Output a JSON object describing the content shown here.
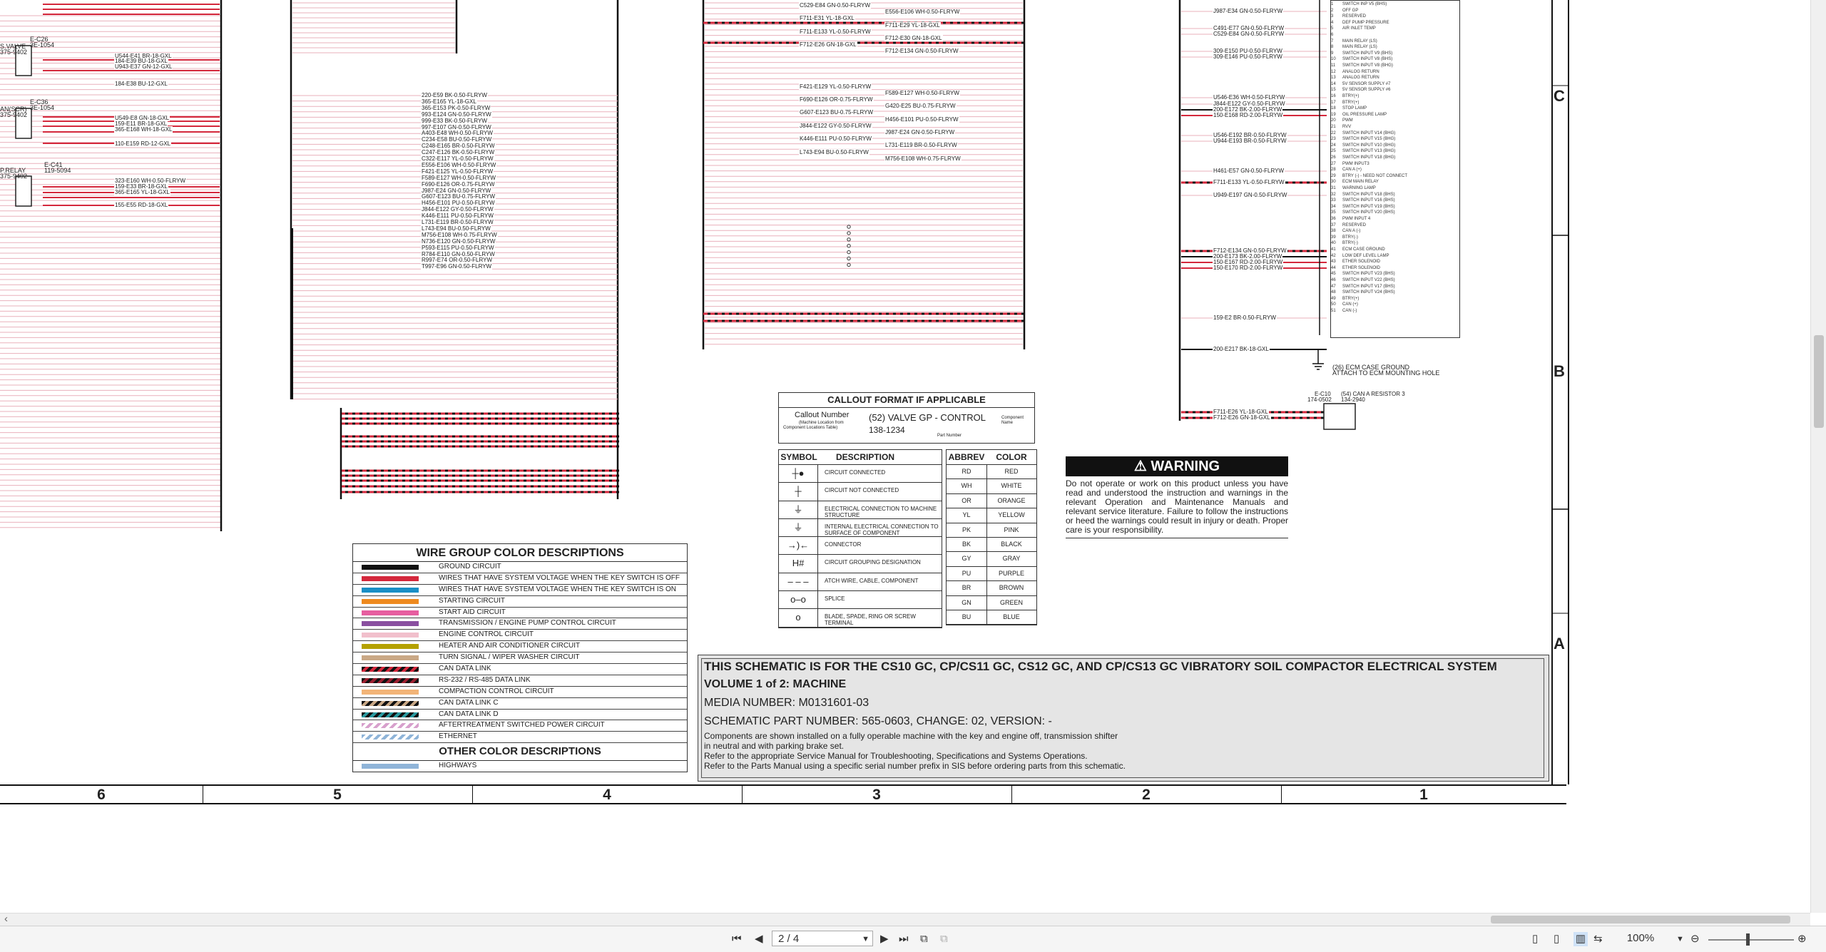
{
  "schematic": {
    "zones_bottom": [
      "6",
      "5",
      "4",
      "3",
      "2",
      "1"
    ],
    "zones_right": [
      "C",
      "B",
      "A"
    ],
    "connector_labels": [
      {
        "name": "E-C26",
        "part": "3E-1054",
        "desc": "S.VALVE",
        "num": "375-9402"
      },
      {
        "name": "E-C36",
        "part": "3E-1054",
        "desc": "AN(SCR)",
        "num": "375-9402"
      },
      {
        "name": "E-C41",
        "part": "119-5094",
        "desc": "P.RELAY",
        "num": "375-9402"
      }
    ],
    "left_wires": [
      "U544-E41 BR-18-GXL",
      "184-E39 BU-18-GXL",
      "U943-E37 GN-12-GXL",
      "184-E38 BU-12-GXL",
      "U549-E8 GN-18-GXL",
      "159-E11 BR-18-GXL",
      "365-E168 WH-18-GXL",
      "110-E159 RD-12-GXL",
      "323-E160 WH-0.50-FLRYW",
      "159-E33 BR-18-GXL",
      "365-E165 YL-18-GXL",
      "155-E55 RD-18-GXL"
    ],
    "mid_wires": [
      "220-E59 BK-0.50-FLRYW",
      "365-E165 YL-18-GXL",
      "365-E153 PK-0.50-FLRYW",
      "993-E124 GN-0.50-FLRYW",
      "999-E33 BK-0.50-FLRYW",
      "997-E107 GN-0.50-FLRYW",
      "A403-E48 WH-0.50-FLRYW",
      "C234-E58 BU-0.50-FLRYW",
      "C248-E165 BR-0.50-FLRYW",
      "C247-E126 BK-0.50-FLRYW",
      "C322-E117 YL-0.50-FLRYW",
      "E556-E106 WH-0.50-FLRYW",
      "F421-E125 YL-0.50-FLRYW",
      "F589-E127 WH-0.50-FLRYW",
      "F690-E126 OR-0.75-FLRYW",
      "J987-E24 GN-0.50-FLRYW",
      "G607-E123 BU-0.75-FLRYW",
      "H456-E101 PU-0.50-FLRYW",
      "J844-E122 GY-0.50-FLRYW",
      "K446-E111 PU-0.50-FLRYW",
      "L731-E119 BR-0.50-FLRYW",
      "L743-E94 BU-0.50-FLRYW",
      "M756-E108 WH-0.75-FLRYW",
      "N736-E120 GN-0.50-FLRYW",
      "P593-E115 PU-0.50-FLRYW",
      "R784-E110 GN-0.50-FLRYW",
      "R997-E74 OR-0.50-FLRYW",
      "T997-E96 GN-0.50-FLRYW"
    ],
    "right_mid_wires": [
      "C529-E84 GN-0.50-FLRYW",
      "E556-E106 WH-0.50-FLRYW",
      "F711-E31 YL-18-GXL",
      "F711-E29 YL-18-GXL",
      "F711-E133 YL-0.50-FLRYW",
      "F712-E30 GN-18-GXL",
      "F712-E26 GN-18-GXL",
      "F712-E134 GN-0.50-FLRYW",
      "F421-E129 YL-0.50-FLRYW",
      "F589-E127 WH-0.50-FLRYW",
      "F690-E126 OR-0.75-FLRYW",
      "G420-E25 BU-0.75-FLRYW",
      "G607-E123 BU-0.75-FLRYW",
      "H456-E101 PU-0.50-FLRYW",
      "J844-E122 GY-0.50-FLRYW",
      "J987-E24 GN-0.50-FLRYW",
      "K446-E111 PU-0.50-FLRYW",
      "L731-E119 BR-0.50-FLRYW",
      "L743-E94 BU-0.50-FLRYW",
      "M756-E108 WH-0.75-FLRYW"
    ],
    "ecm_wires": [
      "J987-E34 GN-0.50-FLRYW",
      "C491-E77 GN-0.50-FLRYW",
      "C529-E84 GN-0.50-FLRYW",
      "309-E150 PU-0.50-FLRYW",
      "309-E146 PU-0.50-FLRYW",
      "U546-E36 WH-0.50-FLRYW",
      "J844-E122 GY-0.50-FLRYW",
      "200-E172 BK-2.00-FLRYW",
      "150-E168 RD-2.00-FLRYW",
      "U546-E192 BR-0.50-FLRYW",
      "U944-E193 BR-0.50-FLRYW",
      "H461-E57 GN-0.50-FLRYW",
      "F711-E133 YL-0.50-FLRYW",
      "U949-E197 GN-0.50-FLRYW",
      "F712-E134 GN-0.50-FLRYW",
      "200-E173 BK-2.00-FLRYW",
      "150-E167 RD-2.00-FLRYW",
      "150-E170 RD-2.00-FLRYW",
      "159-E2 BR-0.50-FLRYW",
      "200-E217 BK-18-GXL",
      "F711-E26 YL-18-GXL",
      "F712-E26 GN-18-GXL"
    ],
    "ecm_pins": [
      "SWITCH INP V5 (BHS)",
      "OFF GP",
      "RESERVED",
      "DEF PUMP PRESSURE",
      "AIR INLET TEMP",
      "",
      "MAIN RELAY (LS)",
      "MAIN RELAY (LS)",
      "SWITCH INPUT V9 (BHS)",
      "SWITCH INPUT V8 (BHS)",
      "SWITCH INPUT V8 (BHG)",
      "ANALOG RETURN",
      "ANALOG RETURN",
      "5V SENSOR SUPPLY #7",
      "5V SENSOR SUPPLY #6",
      "BTRY(+)",
      "BTRY(+)",
      "STOP LAMP",
      "OIL PRESSURE LAMP",
      "PWM",
      "RVV",
      "SWITCH INPUT V14 (BHG)",
      "SWITCH INPUT V15 (BHG)",
      "SWITCH INPUT V10 (BHG)",
      "SWITCH INPUT V13 (BHG)",
      "SWITCH INPUT V18 (BHG)",
      "PWM INPUT3",
      "CAN A (+)",
      "BTRY (-) - NEED NOT CONNECT",
      "ECM MAIN RELAY",
      "WARNING LAMP",
      "SWITCH INPUT V18 (BHS)",
      "SWITCH INPUT V16 (BHS)",
      "SWITCH INPUT V19 (BHS)",
      "SWITCH INPUT V20 (BHS)",
      "PWM INPUT 4",
      "RESERVED",
      "CAN A (-)",
      "BTRY(-)",
      "BTRY(-)",
      "ECM CASE GROUND",
      "LOW DEF LEVEL LAMP",
      "ETHER SOLENOID",
      "ETHER SOLENOID",
      "SWITCH INPUT V23 (BHS)",
      "SWITCH INPUT V22 (BHS)",
      "SWITCH INPUT V17 (BHS)",
      "SWITCH INPUT V24 (BHS)",
      "BTRY(+)",
      "CAN (+)",
      "CAN (-)"
    ],
    "ground_note": "(26) ECM CASE GROUND",
    "ground_note2": "ATTACH TO ECM MOUNTING HOLE",
    "resistor_label": "E-C10",
    "resistor_part": "174-0502",
    "resistor_desc": "(54) CAN A RESISTOR 3",
    "resistor_num": "134-2940"
  },
  "wire_group": {
    "title": "WIRE GROUP COLOR DESCRIPTIONS",
    "rows": [
      {
        "color": "#111111",
        "label": "GROUND CIRCUIT"
      },
      {
        "color": "#d4283c",
        "label": "WIRES THAT HAVE SYSTEM VOLTAGE WHEN THE KEY SWITCH IS OFF"
      },
      {
        "color": "#1a8fc6",
        "label": "WIRES THAT HAVE SYSTEM VOLTAGE WHEN THE KEY SWITCH IS ON"
      },
      {
        "color": "#ee8a1e",
        "label": "STARTING CIRCUIT"
      },
      {
        "color": "#e65ea0",
        "label": "START AID CIRCUIT"
      },
      {
        "color": "#8a4fa0",
        "label": "TRANSMISSION / ENGINE PUMP CONTROL CIRCUIT"
      },
      {
        "color": "#f1c0cc",
        "label": "ENGINE CONTROL CIRCUIT"
      },
      {
        "color": "#b4a100",
        "label": "HEATER AND AIR CONDITIONER CIRCUIT"
      },
      {
        "color": "#c9a886",
        "label": "TURN SIGNAL / WIPER WASHER CIRCUIT"
      },
      {
        "color": "hatch-red",
        "label": "CAN DATA LINK"
      },
      {
        "color": "hatch-dkred",
        "label": "RS-232 / RS-485 DATA LINK"
      },
      {
        "color": "#f2b478",
        "label": "COMPACTION CONTROL CIRCUIT"
      },
      {
        "color": "hatch-tan",
        "label": "CAN DATA LINK C"
      },
      {
        "color": "hatch-teal",
        "label": "CAN DATA LINK D"
      },
      {
        "color": "hatch-pink",
        "label": "AFTERTREATMENT SWITCHED POWER CIRCUIT"
      },
      {
        "color": "hatch-blue",
        "label": "ETHERNET"
      }
    ],
    "other_title": "OTHER COLOR DESCRIPTIONS",
    "other_rows": [
      {
        "color": "#8fb4d8",
        "label": "HIGHWAYS"
      }
    ]
  },
  "callout": {
    "title": "CALLOUT FORMAT IF APPLICABLE",
    "callout_number": "Callout Number",
    "machine_loc": "(Machine Location from",
    "loc_table": "Component Locations Table)",
    "example": "(52) VALVE GP - CONTROL",
    "part": "138-1234",
    "component_name": "Component",
    "name_word": "Name",
    "part_number": "Part Number"
  },
  "symbols": {
    "h_symbol": "SYMBOL",
    "h_desc": "DESCRIPTION",
    "rows": [
      {
        "sym": "┼●",
        "desc": "CIRCUIT CONNECTED"
      },
      {
        "sym": "┼",
        "desc": "CIRCUIT NOT CONNECTED"
      },
      {
        "sym": "⏚",
        "desc": "ELECTRICAL CONNECTION TO MACHINE STRUCTURE"
      },
      {
        "sym": "⏚",
        "desc": "INTERNAL ELECTRICAL CONNECTION TO SURFACE OF COMPONENT"
      },
      {
        "sym": "→)←",
        "desc": "CONNECTOR"
      },
      {
        "sym": "H#",
        "desc": "CIRCUIT GROUPING DESIGNATION"
      },
      {
        "sym": "– – –",
        "desc": "ATCH WIRE, CABLE, COMPONENT"
      },
      {
        "sym": "o–o",
        "desc": "SPLICE"
      },
      {
        "sym": "o",
        "desc": "BLADE, SPADE, RING OR SCREW TERMINAL"
      }
    ]
  },
  "abbrev": {
    "h_abbrev": "ABBREV",
    "h_color": "COLOR",
    "rows": [
      {
        "a": "RD",
        "c": "RED"
      },
      {
        "a": "WH",
        "c": "WHITE"
      },
      {
        "a": "OR",
        "c": "ORANGE"
      },
      {
        "a": "YL",
        "c": "YELLOW"
      },
      {
        "a": "PK",
        "c": "PINK"
      },
      {
        "a": "BK",
        "c": "BLACK"
      },
      {
        "a": "GY",
        "c": "GRAY"
      },
      {
        "a": "PU",
        "c": "PURPLE"
      },
      {
        "a": "BR",
        "c": "BROWN"
      },
      {
        "a": "GN",
        "c": "GREEN"
      },
      {
        "a": "BU",
        "c": "BLUE"
      }
    ]
  },
  "warning": {
    "title": "WARNING",
    "body": "Do not operate or work on this product unless you have read and understood the instruction and warnings in the relevant Operation and Maintenance Manuals and relevant service literature. Failure to follow the instructions or heed the warnings could result in injury or death. Proper care is your responsibility."
  },
  "title_block": {
    "line1": "THIS SCHEMATIC IS FOR THE CS10 GC, CP/CS11 GC, CS12 GC, AND CP/CS13 GC VIBRATORY SOIL COMPACTOR ELECTRICAL SYSTEM",
    "line2": "VOLUME 1 of 2: MACHINE",
    "line3": "MEDIA NUMBER: M0131601-03",
    "line4": "SCHEMATIC PART NUMBER: 565-0603, CHANGE: 02, VERSION: -",
    "note1": "Components are shown installed on a fully operable machine with the key and engine off, transmission shifter",
    "note2": "in neutral and with parking brake set.",
    "note3": "Refer to the appropriate Service Manual for Troubleshooting, Specifications and Systems Operations.",
    "note4": "Refer to the Parts Manual using a specific serial number prefix in SIS before ordering parts from this schematic."
  },
  "viewer": {
    "hscroll_left": "‹",
    "page_field": "2 / 4",
    "zoom": "100%",
    "nav_first": "⏮",
    "nav_prev": "◀",
    "nav_next": "▶",
    "nav_last": "⏭",
    "zoom_out": "⊖",
    "zoom_in": "⊕",
    "view_icons": [
      "▯",
      "▯",
      "▥",
      "⇆"
    ]
  }
}
